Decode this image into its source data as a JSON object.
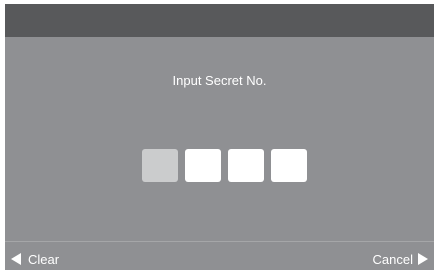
{
  "dialog": {
    "prompt": "Input Secret No.",
    "digit_count": 4,
    "active_digit_index": 0
  },
  "softkeys": {
    "left_label": "Clear",
    "right_label": "Cancel"
  },
  "colors": {
    "screen_background": "#8f9093",
    "title_bar": "#58595b",
    "pin_box": "#ffffff",
    "pin_box_active": "#cbcccd",
    "text": "#ffffff"
  },
  "icons": {
    "left_softkey": "triangle-left-icon",
    "right_softkey": "triangle-right-icon"
  }
}
